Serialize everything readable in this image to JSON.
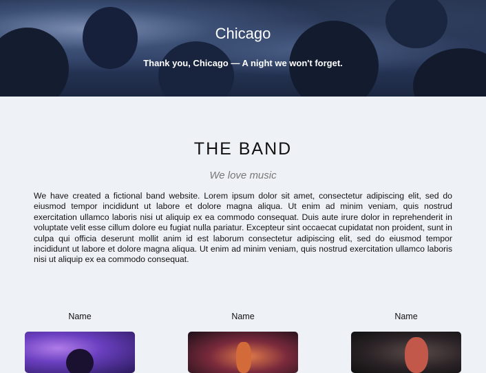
{
  "hero": {
    "title": "Chicago",
    "subtitle": "Thank you, Chicago — A night we won't forget."
  },
  "band": {
    "title": "THE BAND",
    "tagline": "We love music",
    "description": "We have created a fictional band website. Lorem ipsum dolor sit amet, consectetur adipiscing elit, sed do eiusmod tempor incididunt ut labore et dolore magna aliqua. Ut enim ad minim veniam, quis nostrud exercitation ullamco laboris nisi ut aliquip ex ea commodo consequat. Duis aute irure dolor in reprehenderit in voluptate velit esse cillum dolore eu fugiat nulla pariatur. Excepteur sint occaecat cupidatat non proident, sunt in culpa qui officia deserunt mollit anim id est laborum consectetur adipiscing elit, sed do eiusmod tempor incididunt ut labore et dolore magna aliqua. Ut enim ad minim veniam, quis nostrud exercitation ullamco laboris nisi ut aliquip ex ea commodo consequat."
  },
  "members": [
    {
      "name": "Name"
    },
    {
      "name": "Name"
    },
    {
      "name": "Name"
    }
  ]
}
